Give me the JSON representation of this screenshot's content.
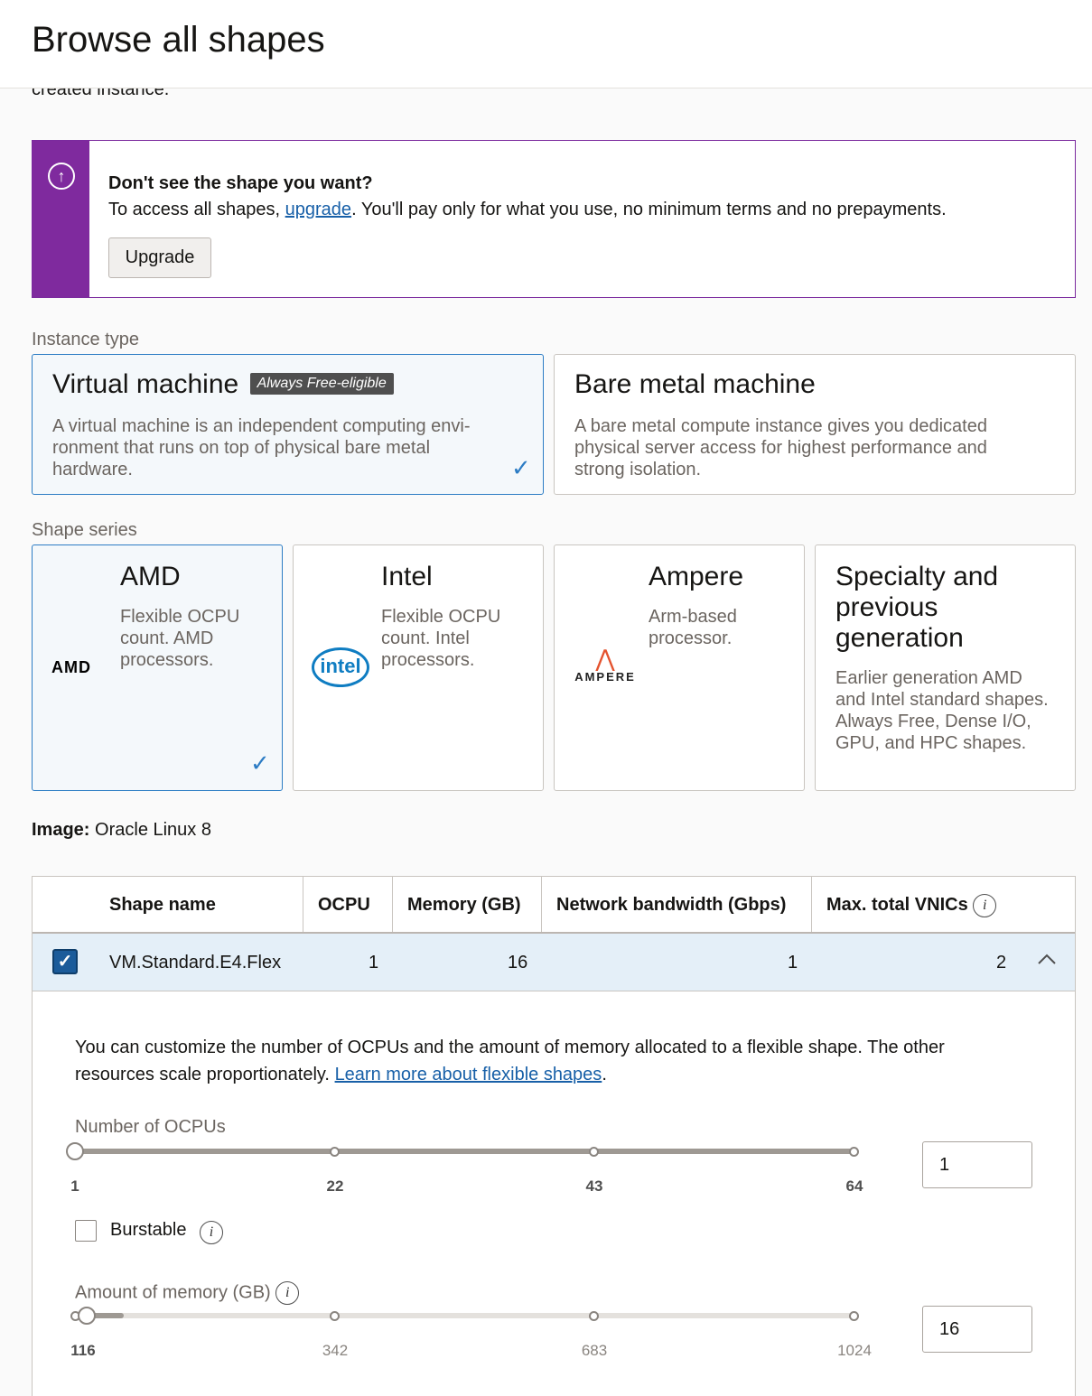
{
  "header": {
    "title": "Browse all shapes"
  },
  "cut_text": "created instance.",
  "notice": {
    "icon": "arrow-up-circle-icon",
    "title": "Don't see the shape you want?",
    "body_prefix": "To access all shapes, ",
    "body_link": "upgrade",
    "body_suffix": ". You'll pay only for what you use, no minimum terms and no prepayments.",
    "button": "Upgrade"
  },
  "instance_type": {
    "label": "Instance type",
    "options": [
      {
        "title": "Virtual machine",
        "badge": "Always Free-eligible",
        "desc": "A virtual machine is an independent computing envi-ronment that runs on top of physical bare metal hardware.",
        "selected": true
      },
      {
        "title": "Bare metal machine",
        "desc": "A bare metal compute instance gives you dedicated physical server access for highest performance and strong isolation.",
        "selected": false
      }
    ]
  },
  "shape_series": {
    "label": "Shape series",
    "options": [
      {
        "title": "AMD",
        "logo": "AMD",
        "desc": "Flexible OCPU count. AMD processors.",
        "selected": true
      },
      {
        "title": "Intel",
        "logo": "intel",
        "desc": "Flexible OCPU count. Intel processors.",
        "selected": false
      },
      {
        "title": "Ampere",
        "logo": "AMPERE",
        "desc": "Arm-based processor.",
        "selected": false
      },
      {
        "title": "Specialty and previous generation",
        "desc": "Earlier generation AMD and Intel standard shapes. Always Free, Dense I/O, GPU, and HPC shapes.",
        "selected": false
      }
    ]
  },
  "image": {
    "label": "Image:",
    "value": "Oracle Linux 8"
  },
  "table": {
    "headers": [
      "Shape name",
      "OCPU",
      "Memory (GB)",
      "Network bandwidth (Gbps)",
      "Max. total VNICs"
    ],
    "row": {
      "name": "VM.Standard.E4.Flex",
      "ocpu": "1",
      "memory": "16",
      "bandwidth": "1",
      "vnics": "2",
      "checked": true,
      "expanded": true
    }
  },
  "flex": {
    "desc_prefix": "You can customize the number of OCPUs and the amount of memory allocated to a flexible shape. The other resources scale proportionately. ",
    "desc_link": "Learn more about flexible shapes",
    "desc_suffix": ".",
    "ocpu": {
      "label": "Number of OCPUs",
      "ticks": [
        "1",
        "22",
        "43",
        "64"
      ],
      "value": "1",
      "min": 1,
      "max": 64
    },
    "burstable": {
      "label": "Burstable",
      "checked": false
    },
    "memory": {
      "label": "Amount of memory (GB)",
      "ticks": [
        "116",
        "342",
        "683",
        "1024"
      ],
      "value": "16"
    }
  },
  "colors": {
    "accent": "#2c7cc4",
    "notice": "#7f2a9e",
    "link": "#1860a8",
    "row_selected": "#e4eff8"
  }
}
